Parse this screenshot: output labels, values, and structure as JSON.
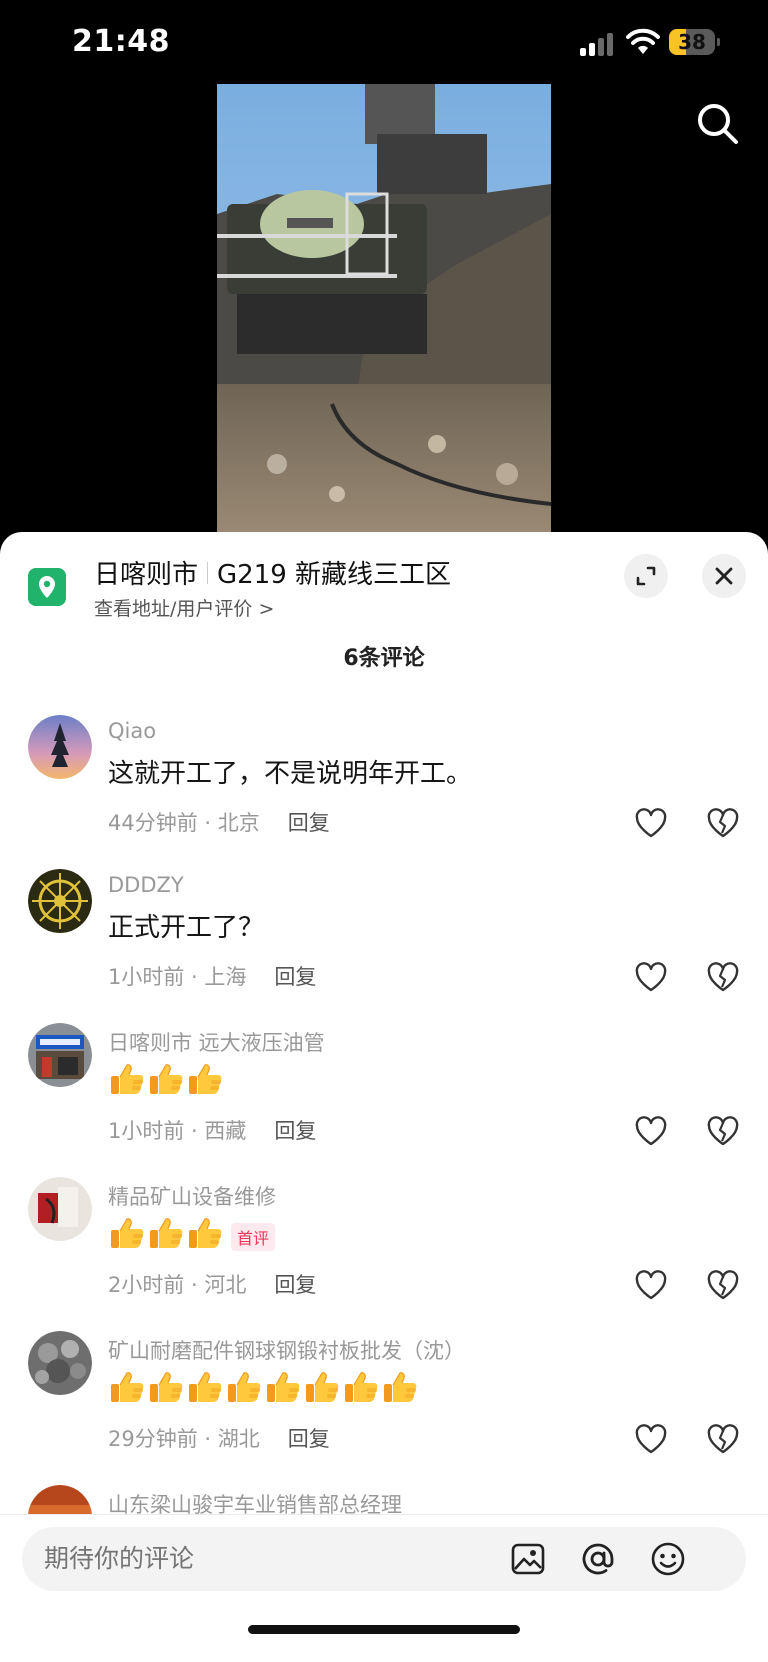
{
  "status": {
    "time": "21:48",
    "battery": "38",
    "battery_level": 0.38
  },
  "location": {
    "city": "日喀则市",
    "place": "G219 新藏线三工区",
    "subtitle": "查看地址/用户评价 >"
  },
  "comments_header": {
    "count": "6条评论"
  },
  "reply_label": "回复",
  "first_badge": "首评",
  "comments": [
    {
      "name": "Qiao",
      "text": "这就开工了，不是说明年开工。",
      "thumbs": 0,
      "meta": "44分钟前 · 北京"
    },
    {
      "name": "DDDZY",
      "text": "正式开工了？",
      "thumbs": 0,
      "meta": "1小时前 · 上海"
    },
    {
      "name": "日喀则市 远大液压油管",
      "text": "",
      "thumbs": 3,
      "meta": "1小时前 · 西藏"
    },
    {
      "name": "精品矿山设备维修",
      "text": "",
      "thumbs": 3,
      "badge": true,
      "meta": "2小时前 · 河北"
    },
    {
      "name": "矿山耐磨配件钢球钢锻衬板批发（沈）",
      "text": "",
      "thumbs": 8,
      "meta": "29分钟前 · 湖北"
    },
    {
      "name": "山东梁山骏宇车业销售部总经理",
      "text": "",
      "thumbs": 0,
      "meta": ""
    }
  ],
  "input": {
    "placeholder": "期待你的评论"
  },
  "colors": {
    "accent_green": "#21b36b",
    "badge_red": "#f2355b",
    "battery_yellow": "#f7c325"
  }
}
